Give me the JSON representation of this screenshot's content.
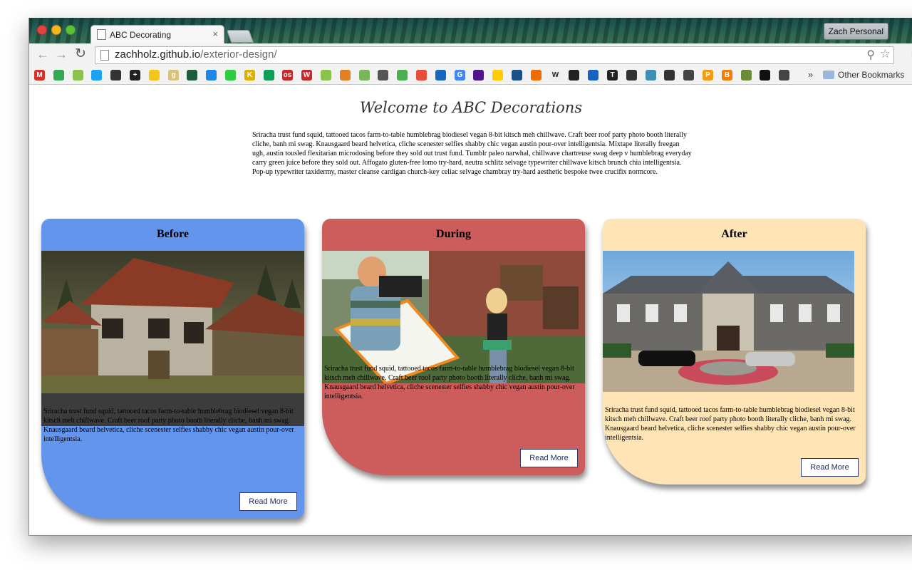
{
  "browser": {
    "tab_title": "ABC Decorating",
    "tab_close": "×",
    "profile_name": "Zach Personal",
    "url_host": "zachholz.github.io",
    "url_path": "/exterior-design/",
    "back_icon": "←",
    "forward_icon": "→",
    "reload_icon": "↻",
    "zoom_icon": "⚲",
    "star_icon": "☆",
    "menu_icon": "≡",
    "bookmarks_more": "»",
    "other_bookmarks": "Other Bookmarks"
  },
  "page": {
    "title": "Welcome to ABC Decorations",
    "intro": "Sriracha trust fund squid, tattooed tacos farm-to-table humblebrag biodiesel vegan 8-bit kitsch meh chillwave. Craft beer roof party photo booth literally cliche, banh mi swag. Knausgaard beard helvetica, cliche scenester selfies shabby chic vegan austin pour-over intelligentsia. Mixtape literally freegan ugh, austin tousled flexitarian microdosing before they sold out trust fund. Tumblr paleo narwhal, chillwave chartreuse swag deep v humblebrag everyday carry green juice before they sold out. Affogato gluten-free lomo try-hard, neutra schlitz selvage typewriter chillwave kitsch brunch chia intelligentsia. Pop-up typewriter taxidermy, master cleanse cardigan church-key celiac selvage chambray try-hard aesthetic bespoke twee crucifix normcore."
  },
  "cards": [
    {
      "title": "Before",
      "color": "#6495ed",
      "image": "dilapidated-house-image",
      "text": "Sriracha trust fund squid, tattooed tacos farm-to-table humblebrag biodiesel vegan 8-bit kitsch meh chillwave. Craft beer roof party photo booth literally cliche, banh mi swag. Knausgaard beard helvetica, cliche scenester selfies shabby chic vegan austin pour-over intelligentsia.",
      "button": "Read More"
    },
    {
      "title": "During",
      "color": "#cd5c5c",
      "image": "camera-crew-image",
      "text": "Sriracha trust fund squid, tattooed tacos farm-to-table humblebrag biodiesel vegan 8-bit kitsch meh chillwave. Craft beer roof party photo booth literally cliche, banh mi swag. Knausgaard beard helvetica, cliche scenester selfies shabby chic vegan austin pour-over intelligentsia.",
      "button": "Read More"
    },
    {
      "title": "After",
      "color": "#ffe4b5",
      "image": "mansion-image",
      "text": "Sriracha trust fund squid, tattooed tacos farm-to-table humblebrag biodiesel vegan 8-bit kitsch meh chillwave. Craft beer roof party photo booth literally cliche, banh mi swag. Knausgaard beard helvetica, cliche scenester selfies shabby chic vegan austin pour-over intelligentsia.",
      "button": "Read More"
    }
  ],
  "bookmark_icons": [
    {
      "name": "gmail-icon",
      "color": "#d93025",
      "glyph": "M"
    },
    {
      "name": "maps-icon",
      "color": "#34a853",
      "glyph": ""
    },
    {
      "name": "android-icon",
      "color": "#8bc34a",
      "glyph": ""
    },
    {
      "name": "twitter-icon",
      "color": "#1da1f2",
      "glyph": ""
    },
    {
      "name": "circle-slash-icon",
      "color": "#333333",
      "glyph": ""
    },
    {
      "name": "plus-box-icon",
      "color": "#222222",
      "glyph": "+"
    },
    {
      "name": "smile-icon",
      "color": "#f5c518",
      "glyph": ""
    },
    {
      "name": "g-icon",
      "color": "#d9c27a",
      "glyph": "g"
    },
    {
      "name": "tree-icon",
      "color": "#1e5c3a",
      "glyph": ""
    },
    {
      "name": "square-blue-icon",
      "color": "#1e88e5",
      "glyph": ""
    },
    {
      "name": "leaf-icon",
      "color": "#2ecc40",
      "glyph": ""
    },
    {
      "name": "kmb-icon",
      "color": "#e0b000",
      "glyph": "K"
    },
    {
      "name": "sheets-icon",
      "color": "#0f9d58",
      "glyph": ""
    },
    {
      "name": "os-icon",
      "color": "#c62828",
      "glyph": "os"
    },
    {
      "name": "w-red-icon",
      "color": "#c62828",
      "glyph": "W"
    },
    {
      "name": "arc-icon",
      "color": "#8bc34a",
      "glyph": ""
    },
    {
      "name": "owl-icon",
      "color": "#e67e22",
      "glyph": ""
    },
    {
      "name": "shopify-icon",
      "color": "#7ab55c",
      "glyph": ""
    },
    {
      "name": "bird-icon",
      "color": "#555555",
      "glyph": ""
    },
    {
      "name": "cloud-icon",
      "color": "#4caf50",
      "glyph": ""
    },
    {
      "name": "target-icon",
      "color": "#e74c3c",
      "glyph": ""
    },
    {
      "name": "n-icon",
      "color": "#1565c0",
      "glyph": ""
    },
    {
      "name": "google-icon",
      "color": "#4285f4",
      "glyph": "G"
    },
    {
      "name": "fedex-icon",
      "color": "#4d148c",
      "glyph": ""
    },
    {
      "name": "dhl-icon",
      "color": "#ffcc00",
      "glyph": ""
    },
    {
      "name": "usps-icon",
      "color": "#1a4f8b",
      "glyph": ""
    },
    {
      "name": "box-icon",
      "color": "#ef6c00",
      "glyph": ""
    },
    {
      "name": "wikipedia-icon",
      "color": "#eeeeee",
      "glyph": "W"
    },
    {
      "name": "o-icon",
      "color": "#222222",
      "glyph": ""
    },
    {
      "name": "person-icon",
      "color": "#1565c0",
      "glyph": ""
    },
    {
      "name": "nyt-icon",
      "color": "#222222",
      "glyph": "T"
    },
    {
      "name": "runner-icon",
      "color": "#333333",
      "glyph": ""
    },
    {
      "name": "parallelogram-icon",
      "color": "#3d8fb5",
      "glyph": ""
    },
    {
      "name": "bike-icon",
      "color": "#333333",
      "glyph": ""
    },
    {
      "name": "chart-icon",
      "color": "#444444",
      "glyph": ""
    },
    {
      "name": "p-icon",
      "color": "#f39c12",
      "glyph": "P"
    },
    {
      "name": "blogger-icon",
      "color": "#f57d00",
      "glyph": "B"
    },
    {
      "name": "photo-icon",
      "color": "#6d8a3a",
      "glyph": ""
    },
    {
      "name": "yellow-square-icon",
      "color": "#111111",
      "glyph": ""
    },
    {
      "name": "robot-icon",
      "color": "#444444",
      "glyph": ""
    }
  ]
}
